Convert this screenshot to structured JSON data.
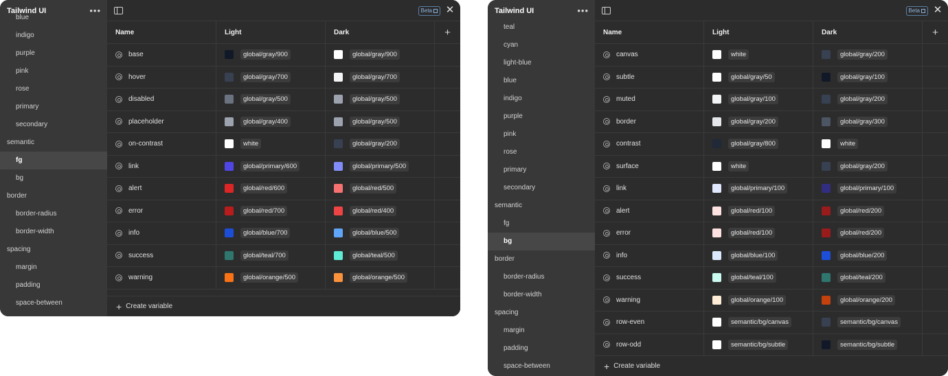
{
  "panels": [
    {
      "app_title": "Tailwind UI",
      "beta_label": "Beta",
      "sidebar": [
        {
          "label": "blue",
          "level": 2
        },
        {
          "label": "indigo",
          "level": 2
        },
        {
          "label": "purple",
          "level": 2
        },
        {
          "label": "pink",
          "level": 2
        },
        {
          "label": "rose",
          "level": 2
        },
        {
          "label": "primary",
          "level": 2
        },
        {
          "label": "secondary",
          "level": 2
        },
        {
          "label": "semantic",
          "level": 1
        },
        {
          "label": "fg",
          "level": 2,
          "active": true
        },
        {
          "label": "bg",
          "level": 2
        },
        {
          "label": "border",
          "level": 1
        },
        {
          "label": "border-radius",
          "level": 2
        },
        {
          "label": "border-width",
          "level": 2
        },
        {
          "label": "spacing",
          "level": 1
        },
        {
          "label": "margin",
          "level": 2
        },
        {
          "label": "padding",
          "level": 2
        },
        {
          "label": "space-between",
          "level": 2
        }
      ],
      "columns": {
        "name": "Name",
        "light": "Light",
        "dark": "Dark"
      },
      "rows": [
        {
          "name": "base",
          "light": "global/gray/900",
          "light_color": "#111827",
          "dark": "global/gray/900",
          "dark_color": "#ffffff"
        },
        {
          "name": "hover",
          "light": "global/gray/700",
          "light_color": "#374151",
          "dark": "global/gray/700",
          "dark_color": "#f3f4f6"
        },
        {
          "name": "disabled",
          "light": "global/gray/500",
          "light_color": "#6b7280",
          "dark": "global/gray/500",
          "dark_color": "#9ca3af"
        },
        {
          "name": "placeholder",
          "light": "global/gray/400",
          "light_color": "#9ca3af",
          "dark": "global/gray/500",
          "dark_color": "#9ca3af"
        },
        {
          "name": "on-contrast",
          "light": "white",
          "light_color": "#ffffff",
          "dark": "global/gray/200",
          "dark_color": "#374151"
        },
        {
          "name": "link",
          "light": "global/primary/600",
          "light_color": "#4f46e5",
          "dark": "global/primary/500",
          "dark_color": "#818cf8"
        },
        {
          "name": "alert",
          "light": "global/red/600",
          "light_color": "#dc2626",
          "dark": "global/red/500",
          "dark_color": "#f87171"
        },
        {
          "name": "error",
          "light": "global/red/700",
          "light_color": "#b91c1c",
          "dark": "global/red/400",
          "dark_color": "#ef4444"
        },
        {
          "name": "info",
          "light": "global/blue/700",
          "light_color": "#1d4ed8",
          "dark": "global/blue/500",
          "dark_color": "#60a5fa"
        },
        {
          "name": "success",
          "light": "global/teal/700",
          "light_color": "#2f766e",
          "dark": "global/teal/500",
          "dark_color": "#5eead4"
        },
        {
          "name": "warning",
          "light": "global/orange/500",
          "light_color": "#f97316",
          "dark": "global/orange/500",
          "dark_color": "#fb923c"
        }
      ],
      "footer": "Create variable"
    },
    {
      "app_title": "Tailwind UI",
      "beta_label": "Beta",
      "sidebar": [
        {
          "label": "teal",
          "level": 2
        },
        {
          "label": "cyan",
          "level": 2
        },
        {
          "label": "light-blue",
          "level": 2
        },
        {
          "label": "blue",
          "level": 2
        },
        {
          "label": "indigo",
          "level": 2
        },
        {
          "label": "purple",
          "level": 2
        },
        {
          "label": "pink",
          "level": 2
        },
        {
          "label": "rose",
          "level": 2
        },
        {
          "label": "primary",
          "level": 2
        },
        {
          "label": "secondary",
          "level": 2
        },
        {
          "label": "semantic",
          "level": 1
        },
        {
          "label": "fg",
          "level": 2
        },
        {
          "label": "bg",
          "level": 2,
          "active": true
        },
        {
          "label": "border",
          "level": 1
        },
        {
          "label": "border-radius",
          "level": 2
        },
        {
          "label": "border-width",
          "level": 2
        },
        {
          "label": "spacing",
          "level": 1
        },
        {
          "label": "margin",
          "level": 2
        },
        {
          "label": "padding",
          "level": 2
        },
        {
          "label": "space-between",
          "level": 2
        }
      ],
      "columns": {
        "name": "Name",
        "light": "Light",
        "dark": "Dark"
      },
      "rows": [
        {
          "name": "canvas",
          "light": "white",
          "light_color": "#ffffff",
          "dark": "global/gray/200",
          "dark_color": "#374151"
        },
        {
          "name": "subtle",
          "light": "global/gray/50",
          "light_color": "#ffffff",
          "dark": "global/gray/100",
          "dark_color": "#111827"
        },
        {
          "name": "muted",
          "light": "global/gray/100",
          "light_color": "#f3f4f6",
          "dark": "global/gray/200",
          "dark_color": "#374151"
        },
        {
          "name": "border",
          "light": "global/gray/200",
          "light_color": "#e5e7eb",
          "dark": "global/gray/300",
          "dark_color": "#4b5563"
        },
        {
          "name": "contrast",
          "light": "global/gray/800",
          "light_color": "#1f2937",
          "dark": "white",
          "dark_color": "#ffffff"
        },
        {
          "name": "surface",
          "light": "white",
          "light_color": "#ffffff",
          "dark": "global/gray/200",
          "dark_color": "#374151"
        },
        {
          "name": "link",
          "light": "global/primary/100",
          "light_color": "#e0e7ff",
          "dark": "global/primary/100",
          "dark_color": "#312e81"
        },
        {
          "name": "alert",
          "light": "global/red/100",
          "light_color": "#fee2e2",
          "dark": "global/red/200",
          "dark_color": "#991b1b"
        },
        {
          "name": "error",
          "light": "global/red/100",
          "light_color": "#fee2e2",
          "dark": "global/red/200",
          "dark_color": "#991b1b"
        },
        {
          "name": "info",
          "light": "global/blue/100",
          "light_color": "#dbeafe",
          "dark": "global/blue/200",
          "dark_color": "#1d4ed8"
        },
        {
          "name": "success",
          "light": "global/teal/100",
          "light_color": "#ccfbf1",
          "dark": "global/teal/200",
          "dark_color": "#2f766e"
        },
        {
          "name": "warning",
          "light": "global/orange/100",
          "light_color": "#ffedd5",
          "dark": "global/orange/200",
          "dark_color": "#c2410c"
        },
        {
          "name": "row-even",
          "light": "semantic/bg/canvas",
          "light_color": "#ffffff",
          "dark": "semantic/bg/canvas",
          "dark_color": "#374151"
        },
        {
          "name": "row-odd",
          "light": "semantic/bg/subtle",
          "light_color": "#ffffff",
          "dark": "semantic/bg/subtle",
          "dark_color": "#111827"
        }
      ],
      "footer": "Create variable"
    }
  ]
}
